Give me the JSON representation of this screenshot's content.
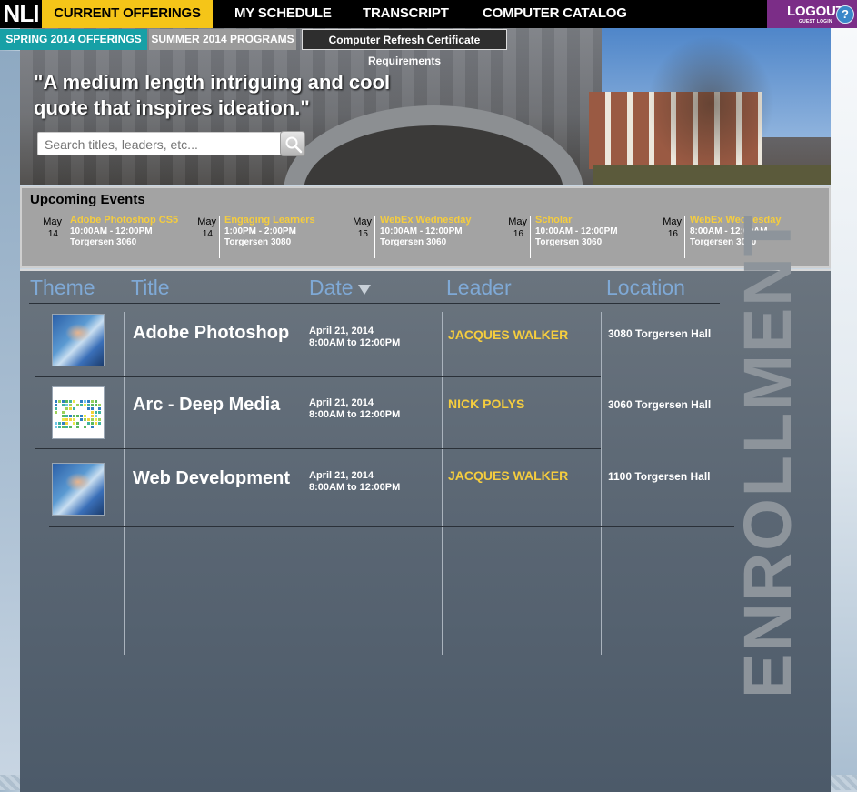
{
  "app": {
    "logo": "NLI"
  },
  "nav": {
    "items": [
      {
        "label": "CURRENT OFFERINGS",
        "active": true
      },
      {
        "label": "MY SCHEDULE",
        "active": false
      },
      {
        "label": "TRANSCRIPT",
        "active": false
      },
      {
        "label": "COMPUTER CATALOG",
        "active": false
      }
    ],
    "logout_label": "LOGOUT",
    "logout_sub": "GUEST LOGIN",
    "help_icon": "?"
  },
  "subtabs": [
    {
      "label": "SPRING 2014 OFFERINGS"
    },
    {
      "label": "SUMMER 2014 PROGRAMS"
    },
    {
      "label": "Computer Refresh Certificate Requirements"
    }
  ],
  "hero": {
    "quote": "\"A medium length intriguing and cool quote that inspires ideation.\"",
    "search_placeholder": "Search titles, leaders, etc..."
  },
  "events": {
    "heading": "Upcoming Events",
    "items": [
      {
        "month": "May",
        "day": "14",
        "title": "Adobe Photoshop CS5",
        "time": "10:00AM - 12:00PM",
        "location": "Torgersen 3060"
      },
      {
        "month": "May",
        "day": "14",
        "title": "Engaging Learners",
        "time": "1:00PM - 2:00PM",
        "location": "Torgersen 3080"
      },
      {
        "month": "May",
        "day": "15",
        "title": "WebEx Wednesday",
        "time": "10:00AM - 12:00PM",
        "location": "Torgersen 3060"
      },
      {
        "month": "May",
        "day": "16",
        "title": "Scholar",
        "time": "10:00AM - 12:00PM",
        "location": "Torgersen 3060"
      },
      {
        "month": "May",
        "day": "16",
        "title": "WebEx Wednesday",
        "time": "8:00AM - 12:00AM",
        "location": "Torgersen 3060"
      }
    ]
  },
  "table": {
    "columns": [
      "Theme",
      "Title",
      "Date",
      "Leader",
      "Location"
    ],
    "sort_column": "Date",
    "rows": [
      {
        "thumb": "science",
        "title": "Adobe Photoshop",
        "date": "April 21, 2014",
        "time": "8:00AM to 12:00PM",
        "leader": "JACQUES WALKER",
        "location": "3080 Torgersen Hall"
      },
      {
        "thumb": "pixels",
        "title": "Arc - Deep Media",
        "date": "April 21, 2014",
        "time": "8:00AM to 12:00PM",
        "leader": "NICK POLYS",
        "location": "3060 Torgersen Hall"
      },
      {
        "thumb": "science",
        "title": "Web Development",
        "date": "April 21, 2014",
        "time": "8:00AM to 12:00PM",
        "leader": "JACQUES WALKER",
        "location": "1100 Torgersen Hall"
      }
    ]
  },
  "sidebar_label": "ENROLLMENT",
  "colors": {
    "accent_yellow": "#f5c518",
    "teal": "#17a0a6",
    "logout_purple": "#7b2d87",
    "leader_gold": "#f5cd3e",
    "column_blue": "#7fa9d6"
  }
}
